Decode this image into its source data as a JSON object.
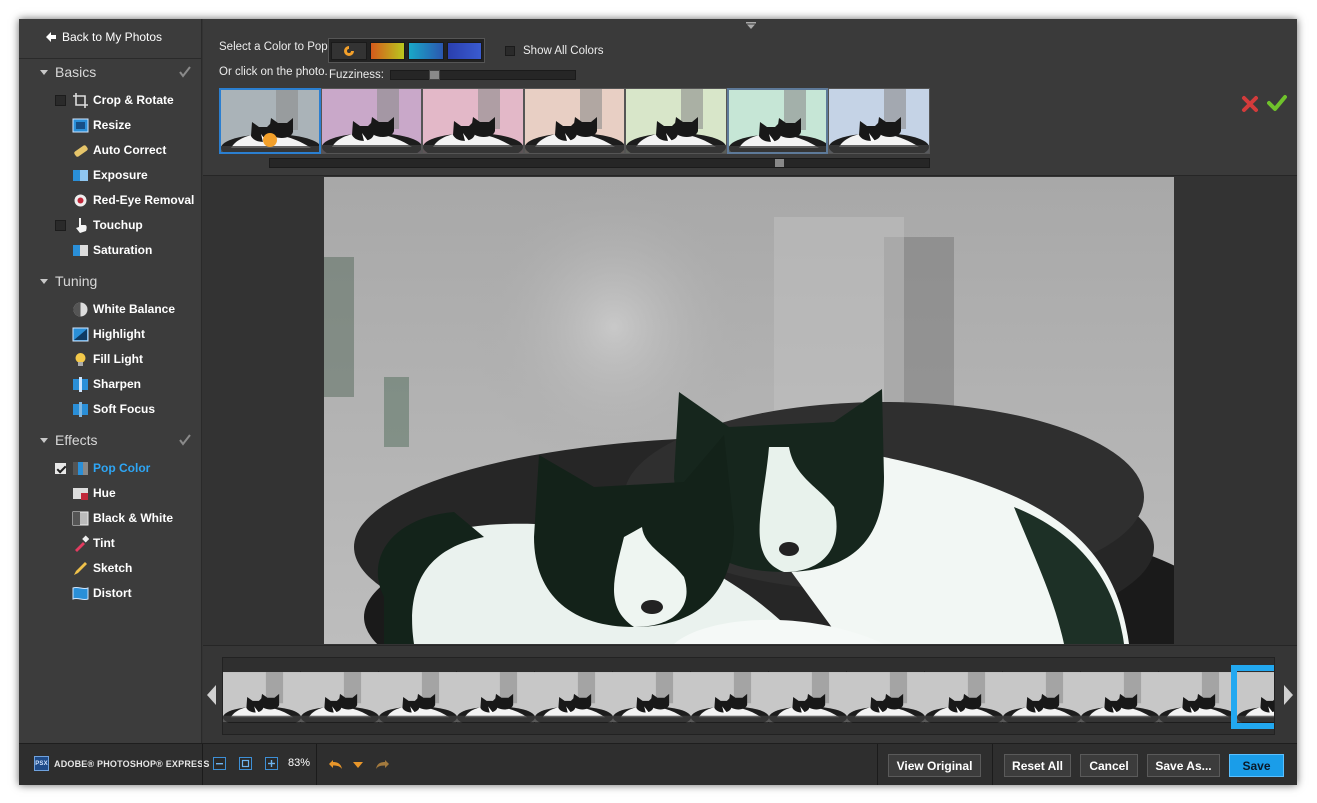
{
  "sidebar": {
    "back_label": "Back to My Photos",
    "sections": [
      {
        "title": "Basics",
        "items": [
          {
            "label": "Crop & Rotate",
            "icon": "crop-icon"
          },
          {
            "label": "Resize",
            "icon": "resize-icon"
          },
          {
            "label": "Auto Correct",
            "icon": "auto-correct-icon"
          },
          {
            "label": "Exposure",
            "icon": "exposure-icon"
          },
          {
            "label": "Red-Eye Removal",
            "icon": "red-eye-icon"
          },
          {
            "label": "Touchup",
            "icon": "touchup-hand-icon"
          },
          {
            "label": "Saturation",
            "icon": "saturation-icon"
          }
        ]
      },
      {
        "title": "Tuning",
        "items": [
          {
            "label": "White Balance",
            "icon": "white-balance-icon"
          },
          {
            "label": "Highlight",
            "icon": "highlight-icon"
          },
          {
            "label": "Fill Light",
            "icon": "lightbulb-icon"
          },
          {
            "label": "Sharpen",
            "icon": "sharpen-icon"
          },
          {
            "label": "Soft Focus",
            "icon": "soft-focus-icon"
          }
        ]
      },
      {
        "title": "Effects",
        "items": [
          {
            "label": "Pop Color",
            "icon": "pop-color-icon",
            "active": true,
            "checked": true
          },
          {
            "label": "Hue",
            "icon": "hue-icon"
          },
          {
            "label": "Black & White",
            "icon": "black-white-icon"
          },
          {
            "label": "Tint",
            "icon": "tint-dropper-icon"
          },
          {
            "label": "Sketch",
            "icon": "sketch-pencil-icon"
          },
          {
            "label": "Distort",
            "icon": "distort-icon"
          }
        ]
      }
    ]
  },
  "pop_color": {
    "select_label": "Select a Color to Pop:",
    "or_click_label": "Or click on the photo.",
    "fuzziness_label": "Fuzziness:",
    "fuzziness_value": 0.22,
    "show_all_label": "Show All Colors",
    "show_all_checked": false,
    "swatches": [
      {
        "name": "orange-swatch",
        "colors": [
          "#3a3a3a",
          "#3a3a3a"
        ]
      },
      {
        "name": "green-yellow-swatch",
        "colors": [
          "#cc5a1e",
          "#b7c61c"
        ]
      },
      {
        "name": "teal-blue-swatch",
        "colors": [
          "#1aa5c4",
          "#2a5fb0"
        ]
      },
      {
        "name": "blue-swatch",
        "colors": [
          "#2a44b0",
          "#3050c8"
        ]
      }
    ],
    "thumbnail_count": 7,
    "selected_thumbnail": 0,
    "hover_thumbnail": 5,
    "thumb_tints": [
      "#aab3b8",
      "#c9a8c9",
      "#e3b8c8",
      "#e8cfc4",
      "#d8e6c9",
      "#c6e6d6",
      "#c5d3e6"
    ]
  },
  "filmstrip": {
    "frame_count": 14,
    "current_frame": 13
  },
  "bottom": {
    "brand": "ADOBE® PHOTOSHOP® EXPRESS",
    "logo_text": "PSX",
    "zoom": "83%",
    "view_original": "View Original",
    "reset_all": "Reset All",
    "cancel": "Cancel",
    "save_as": "Save As...",
    "save": "Save"
  },
  "colors": {
    "accent": "#2ea6f5",
    "primary_button": "#1a9de9",
    "cancel_x": "#d33b3b",
    "apply_check": "#6fc22b"
  }
}
